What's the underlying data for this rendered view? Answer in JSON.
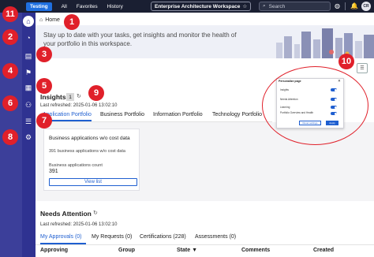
{
  "topbar": {
    "instance": "Testing",
    "nav": [
      "All",
      "Favorites",
      "History"
    ],
    "workspace": "Enterprise Architecture Workspace",
    "search_placeholder": "Search",
    "avatar_initials": "CR"
  },
  "callouts": [
    "1",
    "2",
    "3",
    "4",
    "5",
    "6",
    "7",
    "8",
    "9",
    "10",
    "11"
  ],
  "breadcrumb": {
    "label": "Home"
  },
  "banner": {
    "text": "Stay up to date with your tasks, get insights and monitor the health of your portfolio in this workspace."
  },
  "insights": {
    "title": "Insights",
    "count": "1",
    "last_refreshed": "Last refreshed: 2025-01-06 13:02:10",
    "tabs": [
      "Application Portfolio",
      "Business Portfolio",
      "Information Portfolio",
      "Technology Portfolio"
    ],
    "card": {
      "title": "Business applications w/o cost data",
      "subtitle": "391 business applications w/o cost data",
      "count_label": "Business applications count",
      "count": "391",
      "button": "View list"
    }
  },
  "popup": {
    "title": "Personalize page",
    "close": "✕",
    "rows": [
      "Insights",
      "Needs Attention",
      "Learning",
      "Portfolio Overview and Health"
    ],
    "reset": "Reset settings",
    "apply": "Apply"
  },
  "needs_attention": {
    "title": "Needs Attention",
    "last_refreshed": "Last refreshed: 2025-01-06 13:02:10",
    "tabs": [
      "My Approvals (0)",
      "My Requests (0)",
      "Certifications (228)",
      "Assessments (0)"
    ],
    "columns": [
      "Approving",
      "Group",
      "State",
      "Comments",
      "Created"
    ]
  },
  "colors": {
    "accent": "#1f5fd0",
    "rail": "#3c3f9a",
    "callout": "#e0202a",
    "topbar": "#1a1f32"
  }
}
